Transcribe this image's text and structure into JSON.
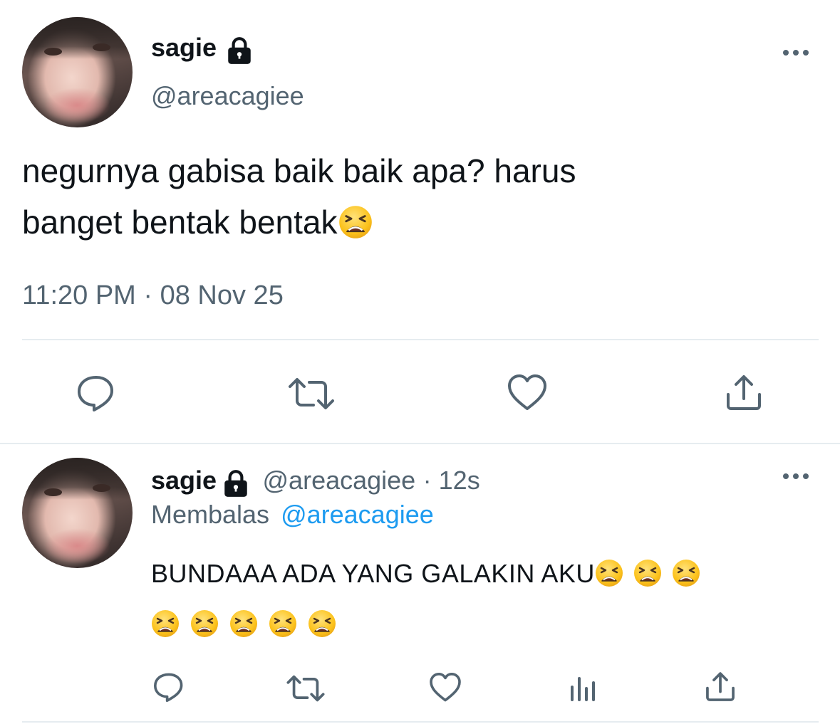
{
  "main_tweet": {
    "display_name": "sagie",
    "handle": "@areacagiee",
    "text_line1": "negurnya gabisa baik baik apa? harus",
    "text_line2": "banget bentak bentak",
    "timestamp": "11:20 PM · 08 Nov 25",
    "emoji": "weary-face",
    "actions": [
      "reply-icon",
      "retweet-icon",
      "like-icon",
      "share-icon"
    ]
  },
  "reply_tweet": {
    "display_name": "sagie",
    "handle": "@areacagiee",
    "time_ago": "· 12s",
    "replying_label": "Membalas",
    "replying_to": "@areacagiee",
    "text": "BUNDAAA ADA YANG GALAKIN AKU",
    "emoji": "weary-face",
    "emoji_count": 8,
    "actions": [
      "reply-icon",
      "retweet-icon",
      "like-icon",
      "views-icon",
      "share-icon"
    ]
  },
  "colors": {
    "text": "#0f1419",
    "secondary": "#536471",
    "link": "#1d9bf0",
    "divider": "#e6ecf0"
  }
}
